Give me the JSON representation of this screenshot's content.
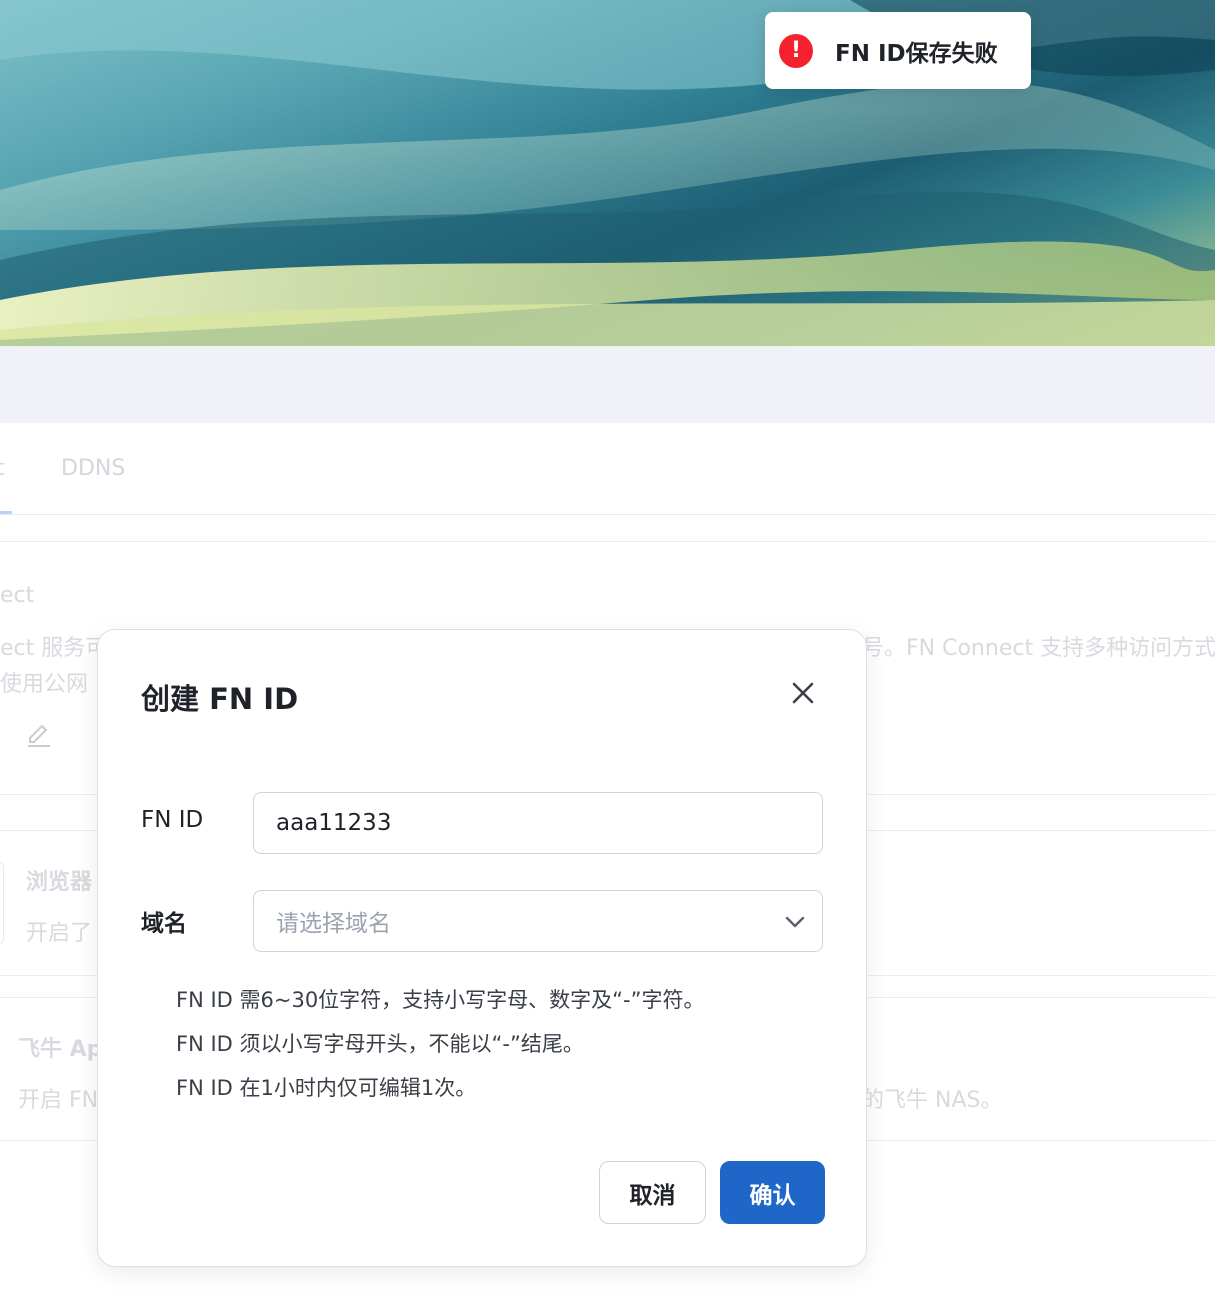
{
  "toast": {
    "icon": "error-icon",
    "icon_glyph": "!",
    "message": "FN ID保存失败",
    "color": "#f5222d"
  },
  "tabs": [
    {
      "label": "t"
    },
    {
      "label": "DDNS"
    }
  ],
  "background": {
    "section_title": "ect",
    "desc_line1_left": "ect 服务可",
    "desc_line1_right": "号。FN Connect 支持多种访问方式",
    "desc_line2_left": "使用公网",
    "browser_title": "浏览器",
    "browser_desc": "开启了",
    "app_title": "飞牛 Ap",
    "app_desc_left": "开启 FN",
    "app_desc_right": "的飞牛 NAS。"
  },
  "dialog": {
    "title": "创建 FN ID",
    "fnid_label": "FN ID",
    "fnid_value": "aaa11233",
    "domain_label": "域名",
    "domain_placeholder": "请选择域名",
    "hints": [
      "FN ID 需6~30位字符，支持小写字母、数字及“-”字符。",
      "FN ID 须以小写字母开头，不能以“-”结尾。",
      "FN ID 在1小时内仅可编辑1次。"
    ],
    "cancel_label": "取消",
    "confirm_label": "确认",
    "primary_color": "#1f66c9"
  }
}
